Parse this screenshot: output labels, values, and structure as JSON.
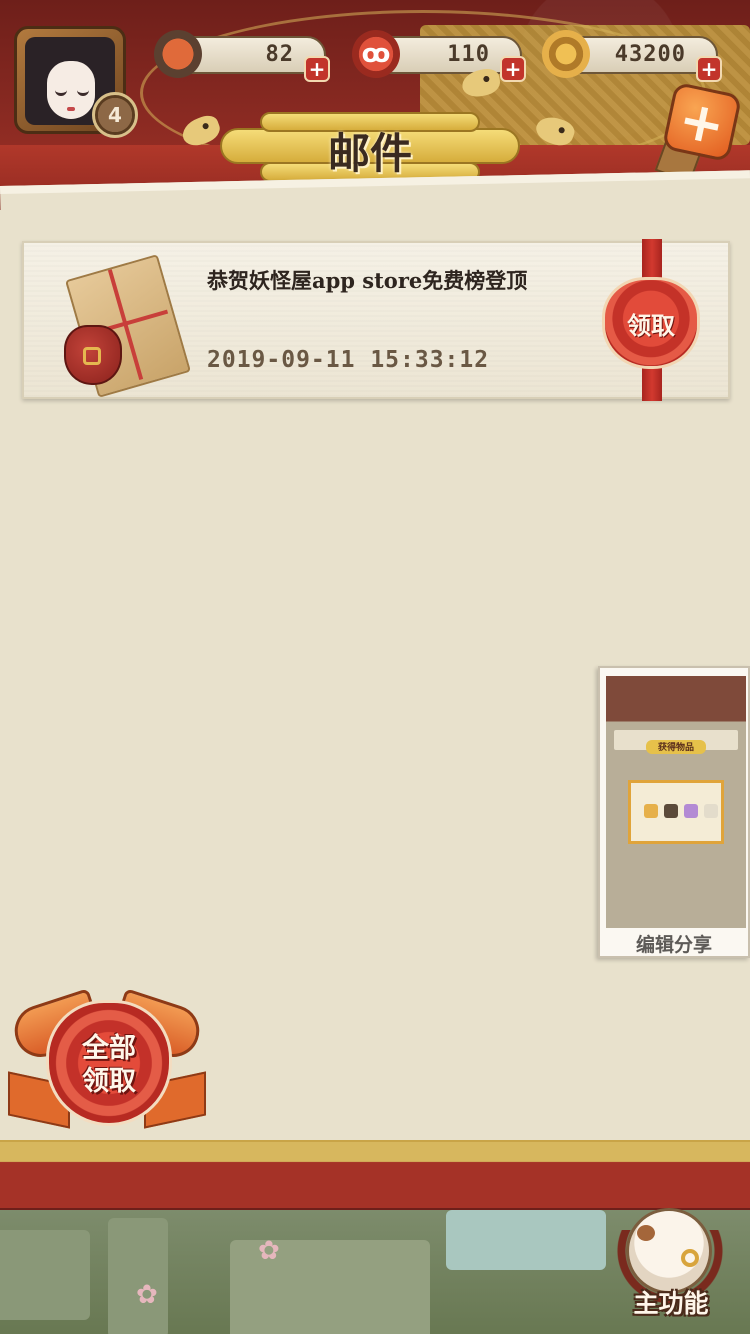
{
  "header": {
    "title": "邮件",
    "player_level": "4",
    "resources": [
      {
        "name": "sushi",
        "icon": "sushi-icon",
        "value": "82",
        "color": "#c9502c"
      },
      {
        "name": "magatama",
        "icon": "magatama-icon",
        "value": "110",
        "color": "#d8402d"
      },
      {
        "name": "coins",
        "icon": "coin-icon",
        "value": "43200",
        "color": "#c98a2e"
      }
    ],
    "plus_symbol": "+"
  },
  "mail": {
    "items": [
      {
        "title": "恭贺妖怪屋app store免费榜登顶",
        "date": "2019-09-11 15:33:12",
        "claim_label": "领取"
      }
    ]
  },
  "share": {
    "label": "编辑分享",
    "thumb_title": "获得物品"
  },
  "collect_all": {
    "line1": "全部",
    "line2": "领取"
  },
  "main_menu": {
    "label": "主功能"
  },
  "colors": {
    "header_red": "#8a2a22",
    "gold": "#d6ad3c",
    "paper": "#e8e1cc",
    "stamp_red": "#c43228"
  }
}
